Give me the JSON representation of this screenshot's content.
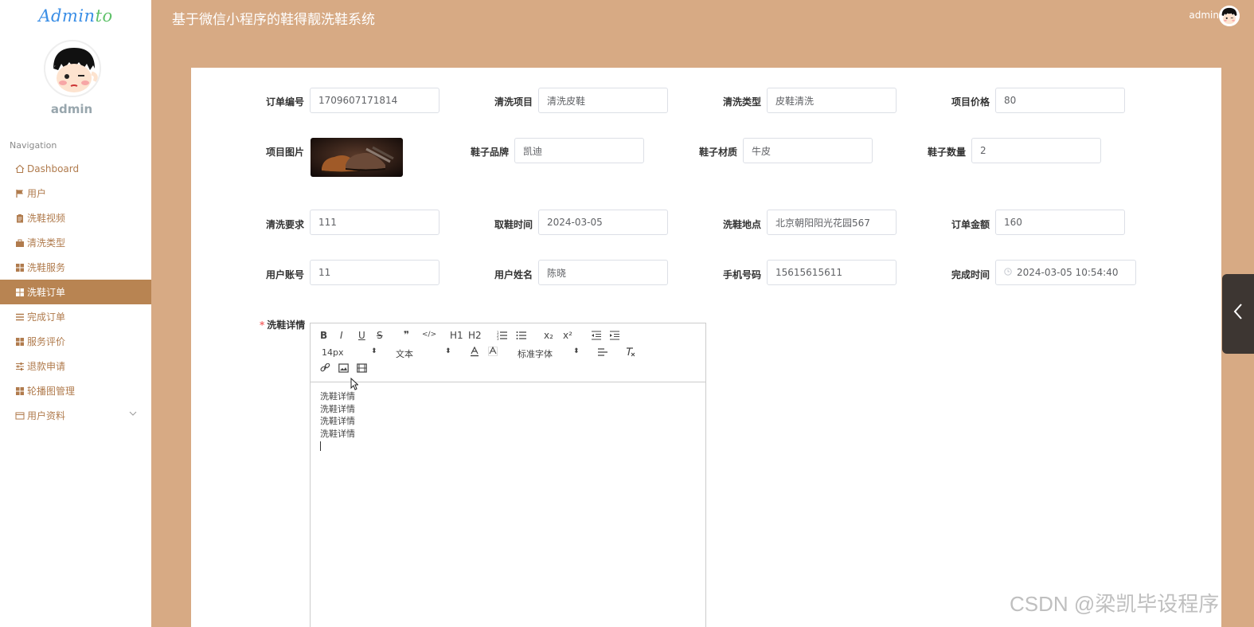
{
  "app": {
    "logo_part1": "Admin",
    "logo_part2": "to",
    "title": "基于微信小程序的鞋得靓洗鞋系统",
    "user": "admin"
  },
  "sidebar": {
    "user_name": "admin",
    "nav_title": "Navigation",
    "items": [
      {
        "label": "Dashboard",
        "icon": "home-icon"
      },
      {
        "label": "用户",
        "icon": "flag-icon"
      },
      {
        "label": "洗鞋视频",
        "icon": "clipboard-icon"
      },
      {
        "label": "清洗类型",
        "icon": "briefcase-icon"
      },
      {
        "label": "洗鞋服务",
        "icon": "grid-icon"
      },
      {
        "label": "洗鞋订单",
        "icon": "grid-icon",
        "active": true
      },
      {
        "label": "完成订单",
        "icon": "list-icon"
      },
      {
        "label": "服务评价",
        "icon": "grid-icon"
      },
      {
        "label": "退款申请",
        "icon": "sliders-icon"
      },
      {
        "label": "轮播图管理",
        "icon": "grid-icon"
      },
      {
        "label": "用户资料",
        "icon": "card-icon",
        "has_submenu": true
      }
    ]
  },
  "form": {
    "order_no": {
      "label": "订单编号",
      "value": "1709607171814"
    },
    "clean_item": {
      "label": "清洗项目",
      "value": "清洗皮鞋"
    },
    "clean_type": {
      "label": "清洗类型",
      "value": "皮鞋清洗"
    },
    "item_price": {
      "label": "项目价格",
      "value": "80"
    },
    "item_image": {
      "label": "项目图片"
    },
    "shoe_brand": {
      "label": "鞋子品牌",
      "value": "凯迪"
    },
    "shoe_material": {
      "label": "鞋子材质",
      "value": "牛皮"
    },
    "shoe_count": {
      "label": "鞋子数量",
      "value": "2"
    },
    "clean_req": {
      "label": "清洗要求",
      "value": "111"
    },
    "pickup_time": {
      "label": "取鞋时间",
      "value": "2024-03-05"
    },
    "address": {
      "label": "洗鞋地点",
      "value": "北京朝阳阳光花园567"
    },
    "order_amount": {
      "label": "订单金额",
      "value": "160"
    },
    "account": {
      "label": "用户账号",
      "value": "11"
    },
    "user_name": {
      "label": "用户姓名",
      "value": "陈晓"
    },
    "phone": {
      "label": "手机号码",
      "value": "15615615611"
    },
    "finish_time": {
      "label": "完成时间",
      "value": "2024-03-05 10:54:40"
    },
    "details": {
      "required_mark": "*",
      "label": "洗鞋详情",
      "lines": [
        "洗鞋详情",
        "洗鞋详情",
        "洗鞋详情",
        "洗鞋详情"
      ]
    }
  },
  "editor": {
    "font_size": "14px",
    "text_style": "文本",
    "font_family": "标准字体",
    "buttons": [
      "B",
      "I",
      "U",
      "S",
      "❞",
      "</>",
      "H1",
      "H2",
      "ordered-list",
      "bullet-list",
      "x₂",
      "x²",
      "outdent",
      "indent"
    ]
  },
  "watermark": "CSDN @梁凯毕设程序"
}
